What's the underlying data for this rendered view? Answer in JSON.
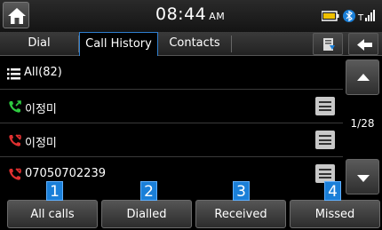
{
  "status": {
    "time": "08:44",
    "ampm": "AM"
  },
  "tabs": [
    {
      "label": "Dial"
    },
    {
      "label": "Call History"
    },
    {
      "label": "Contacts"
    }
  ],
  "filter": {
    "label": "All(82)"
  },
  "rows": [
    {
      "name": "이정미",
      "type": "outgoing",
      "color": "#2ecc40"
    },
    {
      "name": "이정미",
      "type": "missed",
      "color": "#e03030"
    },
    {
      "name": "07050702239",
      "type": "missed",
      "color": "#e03030"
    }
  ],
  "page_indicator": "1/28",
  "bottom_buttons": [
    {
      "label": "All calls",
      "badge": "1"
    },
    {
      "label": "Dialled",
      "badge": "2"
    },
    {
      "label": "Received",
      "badge": "3"
    },
    {
      "label": "Missed",
      "badge": "4"
    }
  ],
  "colors": {
    "accent": "#1a7fd8",
    "active_tab_border": "#2f7fd0"
  }
}
